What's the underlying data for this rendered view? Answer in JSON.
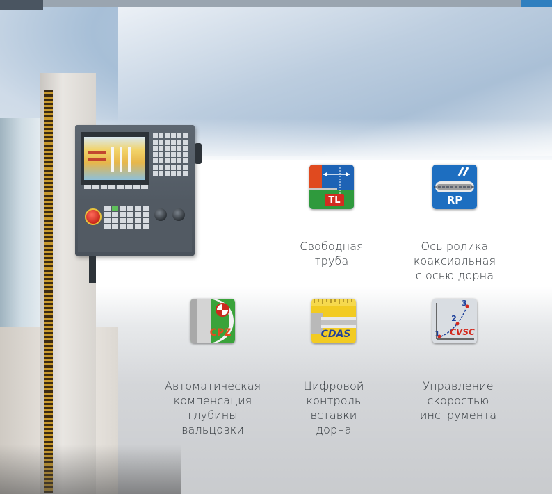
{
  "features": [
    {
      "id": "tl",
      "badge": "TL",
      "lines": [
        "Свободная",
        "труба"
      ]
    },
    {
      "id": "rp",
      "badge": "RP",
      "lines": [
        "Ось ролика",
        "коаксиальная",
        "с осью дорна"
      ]
    },
    {
      "id": "cpz",
      "badge": "CPZ",
      "lines": [
        "Автоматическая",
        "компенсация",
        "глубины",
        "вальцовки"
      ]
    },
    {
      "id": "cdas",
      "badge": "CDAS",
      "lines": [
        "Цифровой",
        "контроль",
        "вставки",
        "дорна"
      ]
    },
    {
      "id": "cvsc",
      "badge": "CVSC",
      "numbers": [
        "1",
        "2",
        "3"
      ],
      "lines": [
        "Управление",
        "скоростью",
        "инструмента"
      ]
    }
  ],
  "colors": {
    "tl_blue": "#1e63b5",
    "tl_green": "#2f9a3d",
    "tl_red": "#d32c20",
    "rp_blue": "#1d6ec0",
    "cpz_green": "#3aa33a",
    "cdas_yellow": "#f2cb22",
    "cdas_blue": "#1f3f9a",
    "cvsc_red": "#d4281c",
    "caption_text": "#2f353a"
  }
}
